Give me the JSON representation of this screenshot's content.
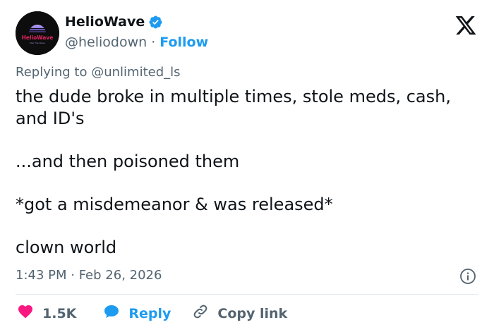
{
  "author": {
    "name": "HelioWave",
    "handle": "@heliodown",
    "separator": "·",
    "follow_label": "Follow",
    "avatar_text": "HelioWave",
    "avatar_subtext": "Feel The Wave",
    "verified_color": "#1d9bf0"
  },
  "reply_context": {
    "prefix": "Replying to",
    "target": "@unlimited_ls"
  },
  "tweet": {
    "line1": "the dude broke in multiple times, stole meds, cash, and ID's",
    "line2": "...and then poisoned them",
    "line3": "*got a misdemeanor & was released*",
    "line4": "clown world"
  },
  "timestamp": "1:43 PM · Feb 26, 2026",
  "actions": {
    "like_count": "1.5K",
    "reply_label": "Reply",
    "copy_label": "Copy link"
  },
  "colors": {
    "accent": "#1d9bf0",
    "like": "#f91880",
    "muted": "#536471",
    "text": "#0f1419"
  }
}
